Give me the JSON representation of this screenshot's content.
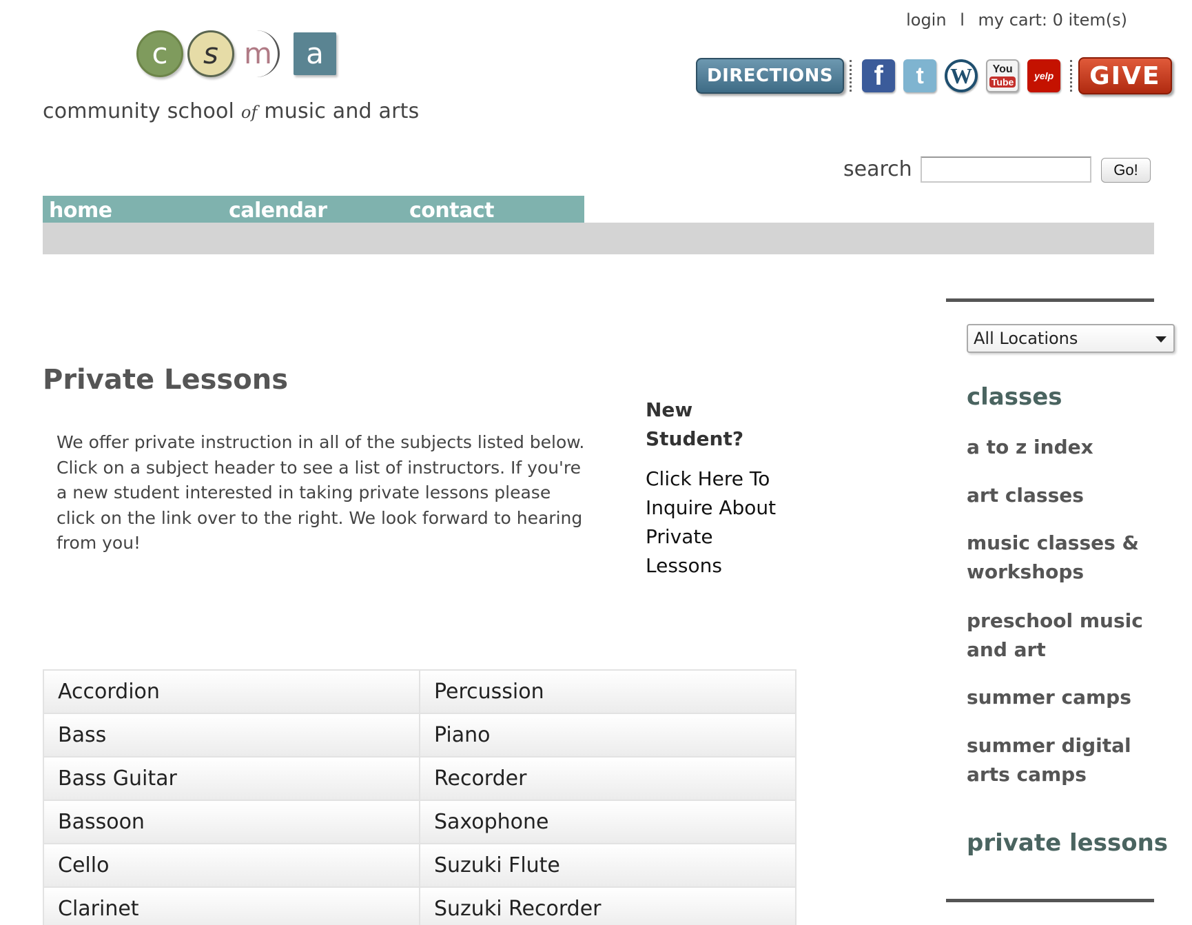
{
  "header": {
    "logo_letters": [
      "c",
      "s",
      "m",
      "a"
    ],
    "logo_text_pre": "community school",
    "logo_text_of": "of",
    "logo_text_post": "music and arts",
    "login": "login",
    "separator": "l",
    "cart_label": "my cart:",
    "cart_count": "0 item(s)",
    "directions_label": "DIRECTIONS",
    "give_label": "GIVE",
    "social_icons": [
      "facebook-icon",
      "twitter-icon",
      "wordpress-icon",
      "youtube-icon",
      "yelp-icon"
    ],
    "youtube_top": "You",
    "youtube_bottom": "Tube",
    "yelp_text": "yelp",
    "facebook_glyph": "f",
    "twitter_glyph": "t",
    "wordpress_glyph": "W",
    "search_label": "search",
    "search_value": "",
    "go_label": "Go!"
  },
  "nav": {
    "items": [
      {
        "label": "home"
      },
      {
        "label": "calendar"
      },
      {
        "label": "contact"
      }
    ],
    "color": "#7fb2ae"
  },
  "main": {
    "title": "Private Lessons",
    "intro": "We offer private instruction in all of the subjects listed below. Click on a subject header to see a list of instructors. If you're a new student interested in taking private lessons please click on the link over to the right. We look forward to hearing from you!",
    "new_student": "New Student?",
    "inquire_link": "Click Here To Inquire About Private Lessons",
    "subjects": [
      [
        "Accordion",
        "Percussion"
      ],
      [
        "Bass",
        "Piano"
      ],
      [
        "Bass Guitar",
        "Recorder"
      ],
      [
        "Bassoon",
        "Saxophone"
      ],
      [
        "Cello",
        "Suzuki Flute"
      ],
      [
        "Clarinet",
        "Suzuki Recorder"
      ]
    ]
  },
  "sidebar": {
    "location_selected": "All Locations",
    "classes_heading": "classes",
    "items": [
      {
        "label": "a to z index"
      },
      {
        "label": "art classes"
      },
      {
        "label": "music classes & workshops"
      },
      {
        "label": "preschool music and art"
      },
      {
        "label": "summer camps"
      },
      {
        "label": "summer digital arts camps"
      }
    ],
    "private_heading": "private lessons"
  },
  "colors": {
    "nav_teal": "#7fb2ae",
    "gray_bar": "#d4d4d4",
    "give_red": "#c0341a",
    "directions_blue": "#4f7d96"
  }
}
